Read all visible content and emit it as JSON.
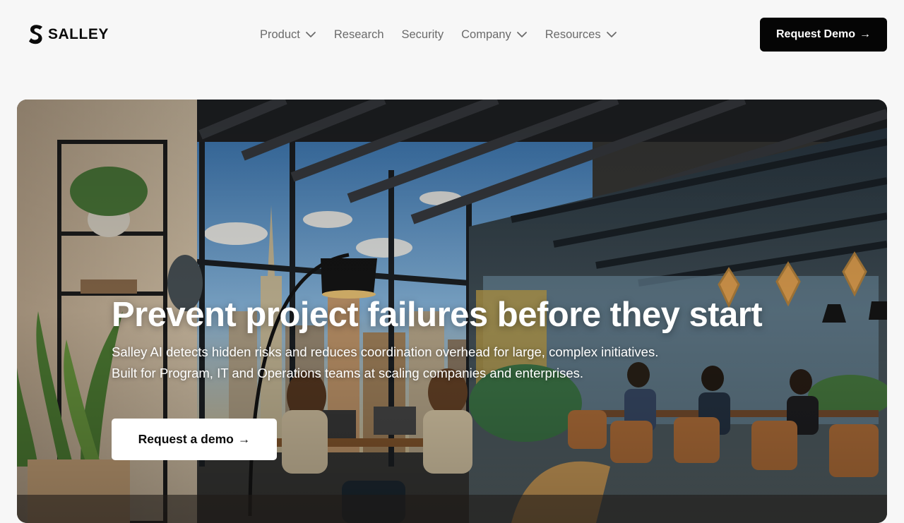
{
  "brand": {
    "name": "SALLEY",
    "logo_icon": "s-mark-icon"
  },
  "nav": {
    "items": [
      {
        "label": "Product",
        "has_dropdown": true
      },
      {
        "label": "Research",
        "has_dropdown": false
      },
      {
        "label": "Security",
        "has_dropdown": false
      },
      {
        "label": "Company",
        "has_dropdown": true
      },
      {
        "label": "Resources",
        "has_dropdown": true
      }
    ]
  },
  "header": {
    "cta_label": "Request Demo",
    "cta_icon": "arrow-right-icon"
  },
  "hero": {
    "title": "Prevent project failures before they start",
    "subtitle_line1": "Salley AI detects hidden risks and reduces coordination overhead for large, complex initiatives.",
    "subtitle_line2": "Built for Program, IT and Operations teams at scaling companies and enterprises.",
    "cta_label": "Request a demo",
    "cta_icon": "arrow-right-icon",
    "image": "illustrated-office-with-city-view"
  },
  "colors": {
    "page_bg": "#f7f7f7",
    "nav_text": "#6b6b6b",
    "primary_button_bg": "#050505",
    "primary_button_text": "#ffffff",
    "hero_text": "#ffffff"
  }
}
